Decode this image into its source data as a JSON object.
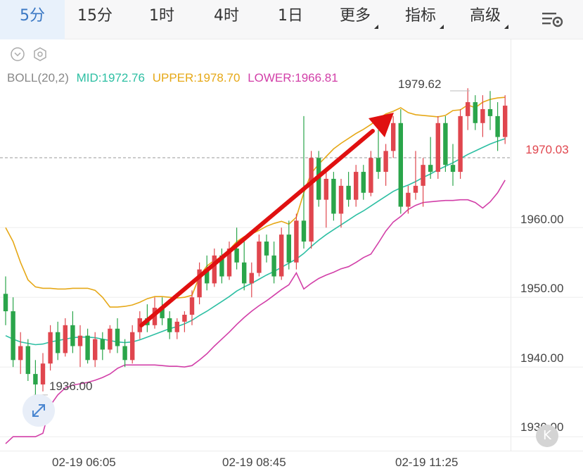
{
  "toolbar": {
    "tabs": [
      {
        "label": "5分",
        "active": true
      },
      {
        "label": "15分",
        "active": false
      },
      {
        "label": "1时",
        "active": false
      },
      {
        "label": "4时",
        "active": false
      },
      {
        "label": "1日",
        "active": false
      },
      {
        "label": "更多",
        "active": false,
        "dropdown": true
      },
      {
        "label": "指标",
        "active": false,
        "dropdown": true
      },
      {
        "label": "高级",
        "active": false,
        "dropdown": true
      }
    ],
    "settings_icon": "chart-settings-icon"
  },
  "indicator": {
    "name": "BOLL(20,2)",
    "mid": "MID:1972.76",
    "upper": "UPPER:1978.70",
    "lower": "LOWER:1966.81",
    "colors": {
      "mid": "#2dbfa3",
      "upper": "#e6a817",
      "lower": "#d23fa8"
    }
  },
  "price_axis": {
    "labels": [
      "1960.00",
      "1950.00",
      "1940.00",
      "1930.00"
    ],
    "last_price": "1970.03"
  },
  "annotations": {
    "high": "1979.62",
    "low": "1936.00"
  },
  "time_axis": {
    "labels": [
      "02-19 06:05",
      "02-19 08:45",
      "02-19 11:25"
    ]
  },
  "colors": {
    "up": "#e0464e",
    "down": "#2aa54a",
    "active_tab": "#3a78c4",
    "trend_arrow": "#e01010"
  },
  "chart_data": {
    "type": "candlestick",
    "ylim": [
      1928,
      1987
    ],
    "candles": [
      {
        "o": 1950.5,
        "h": 1953,
        "l": 1946,
        "c": 1948
      },
      {
        "o": 1948,
        "h": 1950,
        "l": 1940,
        "c": 1941
      },
      {
        "o": 1941,
        "h": 1945,
        "l": 1939,
        "c": 1943
      },
      {
        "o": 1943,
        "h": 1944,
        "l": 1938,
        "c": 1939
      },
      {
        "o": 1939,
        "h": 1941,
        "l": 1936,
        "c": 1937.5
      },
      {
        "o": 1937.5,
        "h": 1942,
        "l": 1936.5,
        "c": 1940.5
      },
      {
        "o": 1940.5,
        "h": 1946,
        "l": 1939.5,
        "c": 1945
      },
      {
        "o": 1945,
        "h": 1946.5,
        "l": 1941,
        "c": 1942
      },
      {
        "o": 1942,
        "h": 1947,
        "l": 1941.5,
        "c": 1946
      },
      {
        "o": 1946,
        "h": 1948,
        "l": 1942,
        "c": 1943
      },
      {
        "o": 1943,
        "h": 1946,
        "l": 1940,
        "c": 1944.5
      },
      {
        "o": 1944.5,
        "h": 1945.5,
        "l": 1940.5,
        "c": 1941
      },
      {
        "o": 1941,
        "h": 1945,
        "l": 1940,
        "c": 1944
      },
      {
        "o": 1944,
        "h": 1945,
        "l": 1941,
        "c": 1942.5
      },
      {
        "o": 1942.5,
        "h": 1946,
        "l": 1942,
        "c": 1945.5
      },
      {
        "o": 1945.5,
        "h": 1947,
        "l": 1942,
        "c": 1943
      },
      {
        "o": 1943,
        "h": 1944,
        "l": 1940,
        "c": 1941
      },
      {
        "o": 1941,
        "h": 1946,
        "l": 1940.5,
        "c": 1945
      },
      {
        "o": 1945,
        "h": 1948,
        "l": 1944,
        "c": 1947
      },
      {
        "o": 1947,
        "h": 1949,
        "l": 1945,
        "c": 1946
      },
      {
        "o": 1946,
        "h": 1950,
        "l": 1945.5,
        "c": 1948.5
      },
      {
        "o": 1948.5,
        "h": 1950,
        "l": 1946,
        "c": 1947
      },
      {
        "o": 1947,
        "h": 1948,
        "l": 1944,
        "c": 1945
      },
      {
        "o": 1945,
        "h": 1947,
        "l": 1944,
        "c": 1946.5
      },
      {
        "o": 1946.5,
        "h": 1948,
        "l": 1945,
        "c": 1947.5
      },
      {
        "o": 1947.5,
        "h": 1951,
        "l": 1946,
        "c": 1950
      },
      {
        "o": 1950,
        "h": 1955,
        "l": 1949,
        "c": 1954
      },
      {
        "o": 1954,
        "h": 1956,
        "l": 1951,
        "c": 1952
      },
      {
        "o": 1952,
        "h": 1957,
        "l": 1951.5,
        "c": 1956
      },
      {
        "o": 1956,
        "h": 1957,
        "l": 1952,
        "c": 1953
      },
      {
        "o": 1953,
        "h": 1958,
        "l": 1952.5,
        "c": 1957
      },
      {
        "o": 1957,
        "h": 1960,
        "l": 1954,
        "c": 1955
      },
      {
        "o": 1955,
        "h": 1958,
        "l": 1951,
        "c": 1952
      },
      {
        "o": 1952,
        "h": 1955,
        "l": 1950,
        "c": 1953.5
      },
      {
        "o": 1953.5,
        "h": 1959,
        "l": 1953,
        "c": 1958
      },
      {
        "o": 1958,
        "h": 1959,
        "l": 1955,
        "c": 1956
      },
      {
        "o": 1956,
        "h": 1958,
        "l": 1952,
        "c": 1953
      },
      {
        "o": 1953,
        "h": 1960,
        "l": 1952.5,
        "c": 1959
      },
      {
        "o": 1959,
        "h": 1961,
        "l": 1954,
        "c": 1955
      },
      {
        "o": 1955,
        "h": 1962,
        "l": 1954,
        "c": 1961
      },
      {
        "o": 1961,
        "h": 1976,
        "l": 1957,
        "c": 1958
      },
      {
        "o": 1958,
        "h": 1971,
        "l": 1957,
        "c": 1970
      },
      {
        "o": 1970,
        "h": 1971,
        "l": 1963,
        "c": 1964
      },
      {
        "o": 1964,
        "h": 1968,
        "l": 1960,
        "c": 1967
      },
      {
        "o": 1967,
        "h": 1968,
        "l": 1961,
        "c": 1962
      },
      {
        "o": 1962,
        "h": 1967,
        "l": 1960,
        "c": 1966
      },
      {
        "o": 1966,
        "h": 1968,
        "l": 1963,
        "c": 1964
      },
      {
        "o": 1964,
        "h": 1969,
        "l": 1963,
        "c": 1968
      },
      {
        "o": 1968,
        "h": 1969,
        "l": 1964,
        "c": 1965
      },
      {
        "o": 1965,
        "h": 1971,
        "l": 1964.5,
        "c": 1970
      },
      {
        "o": 1970,
        "h": 1974,
        "l": 1967,
        "c": 1968
      },
      {
        "o": 1968,
        "h": 1972,
        "l": 1966,
        "c": 1971
      },
      {
        "o": 1971,
        "h": 1976,
        "l": 1970,
        "c": 1975
      },
      {
        "o": 1975,
        "h": 1977,
        "l": 1962,
        "c": 1963
      },
      {
        "o": 1963,
        "h": 1966,
        "l": 1962,
        "c": 1965
      },
      {
        "o": 1965,
        "h": 1971,
        "l": 1964,
        "c": 1966
      },
      {
        "o": 1966,
        "h": 1970,
        "l": 1963,
        "c": 1969
      },
      {
        "o": 1969,
        "h": 1973,
        "l": 1967,
        "c": 1968
      },
      {
        "o": 1968,
        "h": 1976,
        "l": 1967,
        "c": 1975
      },
      {
        "o": 1975,
        "h": 1976,
        "l": 1968,
        "c": 1969
      },
      {
        "o": 1969,
        "h": 1972,
        "l": 1966,
        "c": 1968
      },
      {
        "o": 1968,
        "h": 1977,
        "l": 1967,
        "c": 1976
      },
      {
        "o": 1976,
        "h": 1980,
        "l": 1974,
        "c": 1978
      },
      {
        "o": 1978,
        "h": 1979,
        "l": 1974,
        "c": 1975
      },
      {
        "o": 1975,
        "h": 1979,
        "l": 1973,
        "c": 1977
      },
      {
        "o": 1977,
        "h": 1979.6,
        "l": 1974,
        "c": 1976
      },
      {
        "o": 1976,
        "h": 1978,
        "l": 1971,
        "c": 1973
      },
      {
        "o": 1973,
        "h": 1979,
        "l": 1972,
        "c": 1977.5
      }
    ],
    "boll_mid": [
      1944.5,
      1944,
      1943.6,
      1943.4,
      1943.2,
      1943.3,
      1943.6,
      1943.8,
      1944,
      1944.2,
      1944.3,
      1944.3,
      1944.2,
      1944,
      1943.8,
      1943.6,
      1943.5,
      1943.6,
      1943.9,
      1944.3,
      1944.7,
      1945.1,
      1945.5,
      1945.8,
      1946.2,
      1946.7,
      1947.4,
      1948,
      1948.7,
      1949.4,
      1950.1,
      1950.9,
      1951.5,
      1952,
      1952.6,
      1953.2,
      1953.7,
      1954.3,
      1954.9,
      1955.5,
      1956.3,
      1957.3,
      1958.2,
      1959,
      1959.7,
      1960.4,
      1961.1,
      1961.8,
      1962.4,
      1963.1,
      1963.8,
      1964.5,
      1965.2,
      1965.7,
      1966.1,
      1966.6,
      1967.2,
      1967.7,
      1968.3,
      1968.8,
      1969.3,
      1969.9,
      1970.5,
      1971,
      1971.5,
      1972,
      1972.4,
      1972.76
    ],
    "boll_upper": [
      1960,
      1958,
      1955,
      1952.5,
      1951.5,
      1951.3,
      1951.3,
      1951.2,
      1951.2,
      1951.3,
      1951.3,
      1951.3,
      1951,
      1950,
      1948.6,
      1948.6,
      1948.7,
      1948.9,
      1949.3,
      1949.8,
      1950.1,
      1950.1,
      1950,
      1949.9,
      1950,
      1950.3,
      1953,
      1954.5,
      1955.3,
      1955.8,
      1956.8,
      1958,
      1958.7,
      1959.1,
      1959.6,
      1960.2,
      1960.6,
      1960.9,
      1960.5,
      1961.5,
      1965,
      1967.8,
      1969.1,
      1970.2,
      1971.3,
      1972.1,
      1972.8,
      1973.5,
      1974.1,
      1974.8,
      1975.6,
      1976.3,
      1976.7,
      1977.2,
      1976.5,
      1976.2,
      1976.1,
      1976,
      1975.9,
      1976.1,
      1976.8,
      1976.9,
      1977.6,
      1977.2,
      1978,
      1978.4,
      1978.6,
      1978.7
    ],
    "boll_lower": [
      1929,
      1930,
      1930,
      1930,
      1930,
      1930.5,
      1934.5,
      1936,
      1937,
      1937.4,
      1937.6,
      1937.8,
      1938.1,
      1938.5,
      1939,
      1939.8,
      1940.3,
      1940.3,
      1940.3,
      1940.3,
      1940.3,
      1940.2,
      1940.1,
      1940.1,
      1940,
      1940.2,
      1941,
      1941.9,
      1943,
      1944,
      1945,
      1946.1,
      1947.1,
      1948,
      1948.8,
      1949.5,
      1950.3,
      1951.1,
      1951.8,
      1953.5,
      1951.2,
      1952,
      1952.7,
      1953.2,
      1953.6,
      1954.1,
      1954.4,
      1955,
      1955.7,
      1956.2,
      1957.8,
      1959.5,
      1960.8,
      1961.6,
      1962.6,
      1963.2,
      1963.6,
      1963.7,
      1963.8,
      1963.9,
      1963.9,
      1964,
      1964,
      1963.6,
      1962.8,
      1963.7,
      1965,
      1966.81
    ]
  }
}
